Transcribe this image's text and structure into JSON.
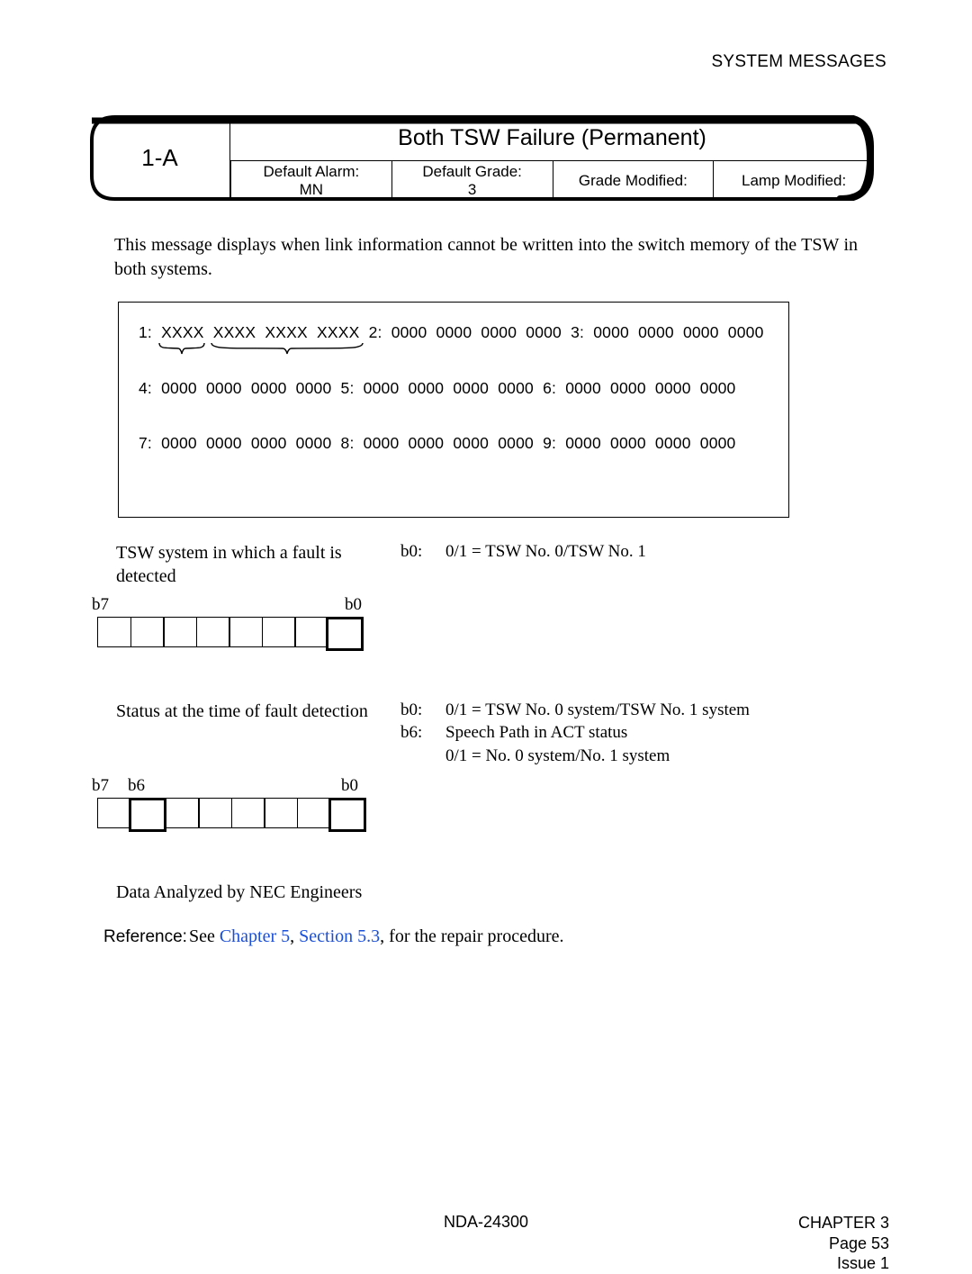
{
  "header": {
    "title": "SYSTEM MESSAGES"
  },
  "card": {
    "code": "1-A",
    "title": "Both TSW Failure (Permanent)",
    "cells": {
      "alarm_label": "Default Alarm:",
      "alarm_value": "MN",
      "grade_label": "Default Grade:",
      "grade_value": "3",
      "gmod_label": "Grade Modified:",
      "gmod_value": "",
      "lmod_label": "Lamp Modified:",
      "lmod_value": ""
    }
  },
  "intro": "This message displays when link information cannot be written into the switch memory of the TSW in both systems.",
  "data_rows": [
    "1:  XXXX  XXXX  XXXX  XXXX  2:  0000  0000  0000  0000  3:  0000  0000  0000  0000",
    "4:  0000  0000  0000  0000  5:  0000  0000  0000  0000  6:  0000  0000  0000  0000",
    "7:  0000  0000  0000  0000  8:  0000  0000  0000  0000  9:  0000  0000  0000  0000"
  ],
  "section1": {
    "label": "TSW system in which a fault is detected",
    "bits_left": "b7",
    "bits_right": "b0",
    "desc": [
      {
        "k": "b0:",
        "v": "0/1 = TSW No. 0/TSW No. 1"
      }
    ]
  },
  "section2": {
    "label": "Status at the time of fault detection",
    "bits_b7": "b7",
    "bits_b6": "b6",
    "bits_b0": "b0",
    "desc": [
      {
        "k": "b0:",
        "v": "0/1 = TSW No. 0 system/TSW No. 1 system"
      },
      {
        "k": "b6:",
        "v": "Speech Path in ACT status"
      },
      {
        "k": "",
        "v": "0/1 = No. 0 system/No. 1 system"
      }
    ]
  },
  "analyzed": "Data Analyzed by NEC Engineers",
  "reference": {
    "label": "Reference:",
    "prefix": "See ",
    "link1": "Chapter 5",
    "sep": ", ",
    "link2": "Section 5.3",
    "suffix": ", for the repair procedure."
  },
  "footer": {
    "center": "NDA-24300",
    "chapter": "CHAPTER 3",
    "page": "Page 53",
    "issue": "Issue 1"
  }
}
